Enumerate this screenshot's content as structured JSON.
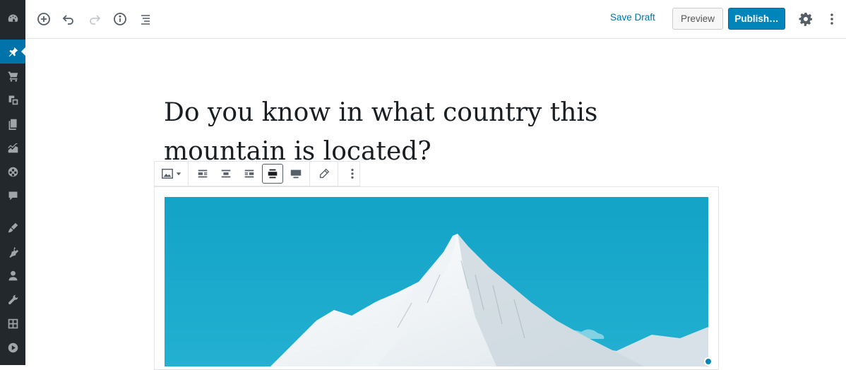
{
  "topbar": {
    "save_draft_label": "Save Draft",
    "preview_label": "Preview",
    "publish_label": "Publish…"
  },
  "post": {
    "title": "Do you know in what country this mountain is located?"
  },
  "colors": {
    "admin_sidebar_bg": "#23282d",
    "admin_active_bg": "#0073aa",
    "primary_button_bg": "#0085ba",
    "link_blue": "#0073aa",
    "sky_blue": "#1aa6c8"
  },
  "icons": {
    "admin_menu": [
      "dashboard-icon",
      "pin-icon",
      "cart-icon",
      "media-icon",
      "pages-icon",
      "chart-icon",
      "palette-icon",
      "comment-icon",
      "brush-icon",
      "plugin-icon",
      "user-icon",
      "wrench-icon",
      "settings-grid-icon",
      "play-icon"
    ],
    "toolbar_left": [
      "add-block-icon",
      "undo-icon",
      "redo-icon",
      "info-icon",
      "outline-icon"
    ],
    "block_toolbar": [
      "image-icon",
      "align-left-icon",
      "align-center-icon",
      "align-right-icon",
      "align-wide-icon",
      "align-full-icon",
      "edit-pencil-icon",
      "more-vertical-icon"
    ]
  }
}
